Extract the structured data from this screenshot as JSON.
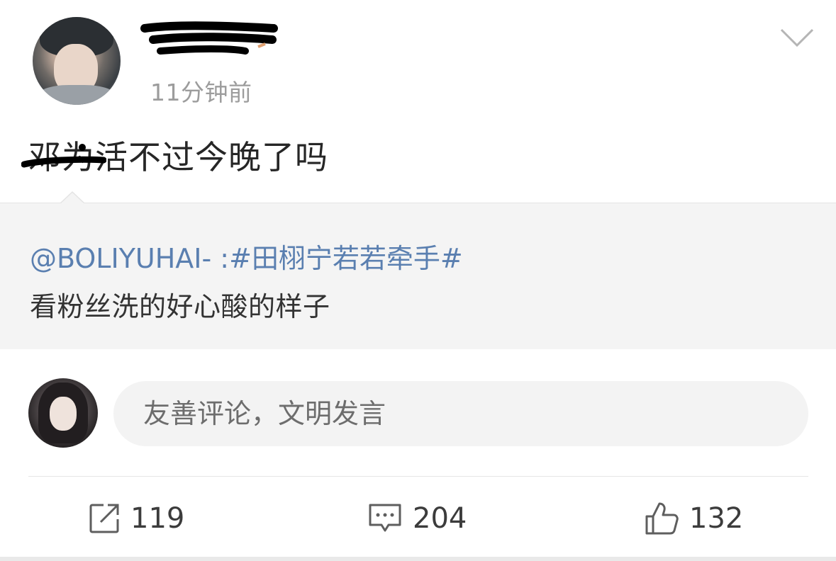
{
  "post": {
    "timestamp": "11分钟前",
    "text": "邓为活不过今晚了吗"
  },
  "quoted": {
    "user": "@BOLIYUHAI-",
    "separator": " :",
    "topic": "#田栩宁若若牵手#",
    "text": "看粉丝洗的好心酸的样子"
  },
  "comment": {
    "placeholder": "友善评论，文明发言"
  },
  "actions": {
    "repost_count": "119",
    "comment_count": "204",
    "like_count": "132"
  },
  "icons": [
    "chevron-down-icon",
    "repost-icon",
    "comment-icon",
    "like-icon"
  ],
  "colors": {
    "link": "#5a7fb0",
    "quote_bg": "#f4f4f4",
    "muted_text": "#9c9c9c"
  }
}
